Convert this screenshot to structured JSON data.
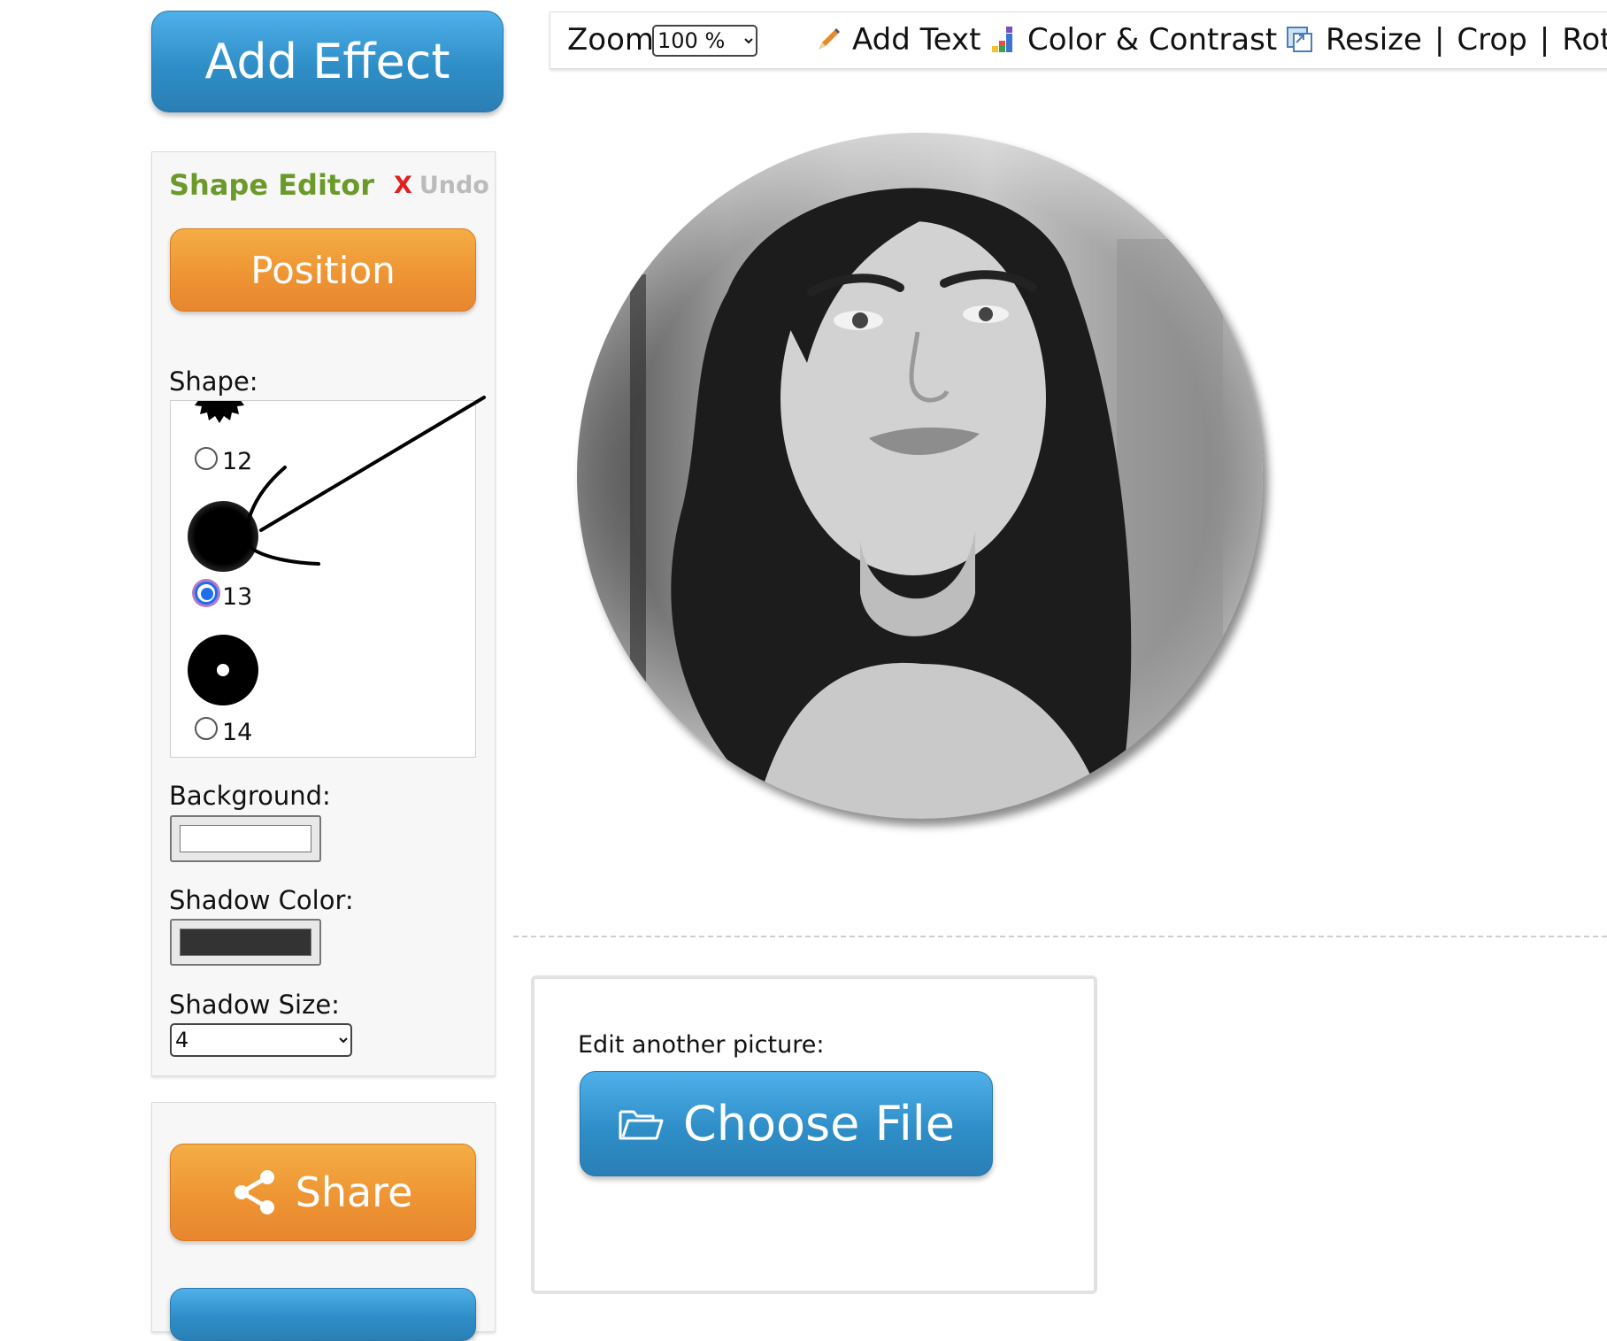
{
  "sidebar": {
    "add_effect_label": "Add Effect",
    "shape_editor": {
      "title": "Shape Editor",
      "undo_x": "X",
      "undo_label": "Undo",
      "position_label": "Position",
      "shape_label": "Shape:",
      "shapes": [
        {
          "id": "12",
          "label": "12",
          "selected": false
        },
        {
          "id": "13",
          "label": "13",
          "selected": true
        },
        {
          "id": "14",
          "label": "14",
          "selected": false
        }
      ],
      "background_label": "Background:",
      "background_color": "#ffffff",
      "shadow_color_label": "Shadow Color:",
      "shadow_color": "#333333",
      "shadow_size_label": "Shadow Size:",
      "shadow_size_value": "4"
    },
    "share_label": "Share"
  },
  "toolbar": {
    "zoom_label": "Zoom:",
    "zoom_value": "100 %",
    "add_text_label": "Add Text",
    "color_contrast_label": "Color & Contrast",
    "resize_label": "Resize",
    "sep1": "|",
    "crop_label": "Crop",
    "sep2": "|",
    "rotate_label": "Rotate"
  },
  "editor": {
    "edit_another_label": "Edit another picture:",
    "choose_file_label": "Choose File"
  },
  "colors": {
    "accent_blue": "#2f8ec7",
    "accent_orange": "#ee9534",
    "title_green": "#6b9a2a",
    "undo_red": "#e02020",
    "undo_gray": "#bbbbbb"
  }
}
